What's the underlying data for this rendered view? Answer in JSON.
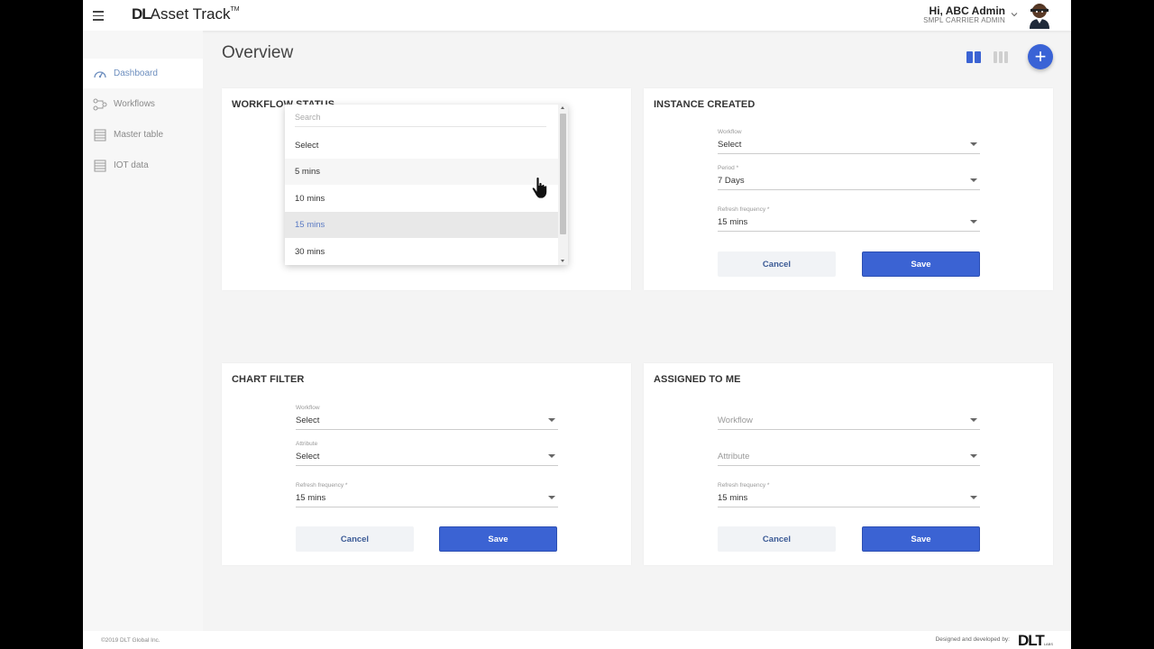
{
  "header": {
    "logo_prefix": "DL",
    "logo_name": "Asset Track",
    "logo_tm": "TM",
    "user_greeting": "Hi, ABC Admin",
    "user_role": "SMPL CARRIER ADMIN"
  },
  "sidebar": {
    "items": [
      {
        "label": "Dashboard",
        "icon": "speedometer-icon",
        "active": true
      },
      {
        "label": "Workflows",
        "icon": "workflow-icon",
        "active": false
      },
      {
        "label": "Master table",
        "icon": "table-icon",
        "active": false
      },
      {
        "label": "IOT data",
        "icon": "table-icon",
        "active": false
      }
    ]
  },
  "page": {
    "title": "Overview",
    "view_icons": [
      "two-column-view-icon",
      "three-column-view-icon"
    ],
    "add_icon": "plus-icon",
    "add_label": "+"
  },
  "cards": {
    "workflow_status": {
      "title": "WORKFLOW STATUS"
    },
    "instance_created": {
      "title": "INSTANCE CREATED",
      "workflow_label": "Workflow",
      "workflow_value": "Select",
      "period_label": "Period *",
      "period_value": "7 Days",
      "refresh_label": "Refresh frequency *",
      "refresh_value": "15 mins",
      "cancel": "Cancel",
      "save": "Save"
    },
    "chart_filter": {
      "title": "CHART FILTER",
      "workflow_label": "Workflow",
      "workflow_value": "Select",
      "attribute_label": "Attribute",
      "attribute_value": "Select",
      "refresh_label": "Refresh frequency *",
      "refresh_value": "15 mins",
      "cancel": "Cancel",
      "save": "Save"
    },
    "assigned_to_me": {
      "title": "ASSIGNED TO ME",
      "workflow_placeholder": "Workflow",
      "attribute_placeholder": "Attribute",
      "refresh_label": "Refresh frequency *",
      "refresh_value": "15 mins",
      "cancel": "Cancel",
      "save": "Save"
    }
  },
  "dropdown": {
    "search_placeholder": "Search",
    "options": [
      "Select",
      "5 mins",
      "10 mins",
      "15 mins",
      "30 mins"
    ],
    "hovered": "5 mins",
    "selected": "15 mins"
  },
  "footer": {
    "copyright": "©2019 DLT Global Inc.",
    "designed_by": "Designed and developed by:",
    "brand": "DLT",
    "brand_sub": "LABS"
  },
  "colors": {
    "accent": "#3b63d3",
    "selected_text": "#5b7bc4",
    "active_nav": "#6e8fbf"
  }
}
